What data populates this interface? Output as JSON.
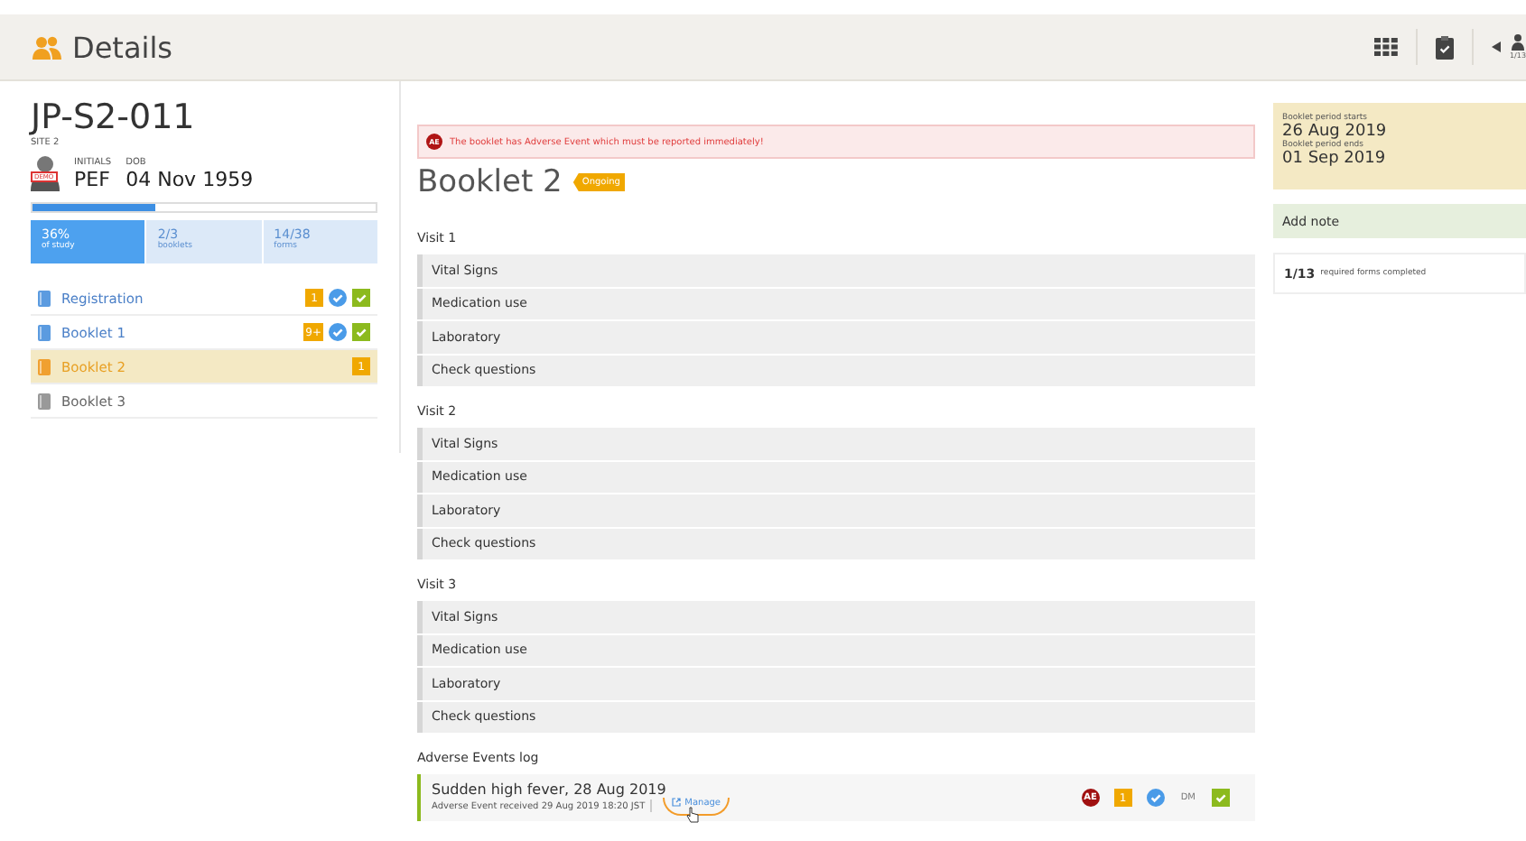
{
  "header": {
    "title": "Details",
    "user_count": "1/13"
  },
  "subject": {
    "id": "JP-S2-011",
    "site": "SITE 2",
    "avatar_tag": "DEMO",
    "initials_label": "INITIALS",
    "initials": "PEF",
    "dob_label": "DOB",
    "dob": "04 Nov 1959",
    "progress": {
      "level": 0.36
    },
    "stats": [
      {
        "value": "36%",
        "label": "of study",
        "selected": true
      },
      {
        "value": "2/3",
        "label": "booklets",
        "selected": false
      },
      {
        "value": "14/38",
        "label": "forms",
        "selected": false
      }
    ]
  },
  "booklets": [
    {
      "label": "Registration",
      "selected": false,
      "locked": false,
      "badges": [
        {
          "kind": "count",
          "text": "1"
        },
        {
          "kind": "verified"
        },
        {
          "kind": "check"
        }
      ]
    },
    {
      "label": "Booklet 1",
      "selected": false,
      "locked": false,
      "badges": [
        {
          "kind": "count",
          "text": "9+"
        },
        {
          "kind": "verified"
        },
        {
          "kind": "check"
        }
      ]
    },
    {
      "label": "Booklet 2",
      "selected": true,
      "locked": false,
      "badges": [
        {
          "kind": "count",
          "text": "1"
        }
      ]
    },
    {
      "label": "Booklet 3",
      "selected": false,
      "locked": true
    }
  ],
  "alert": {
    "badge": "AE",
    "text": "The booklet has Adverse Event which must be reported immediately!"
  },
  "booklet": {
    "title": "Booklet 2",
    "status": "Ongoing"
  },
  "visits": [
    {
      "title": "Visit 1",
      "forms": [
        "Vital Signs",
        "Medication use",
        "Laboratory",
        "Check questions"
      ]
    },
    {
      "title": "Visit 2",
      "forms": [
        "Vital Signs",
        "Medication use",
        "Laboratory",
        "Check questions"
      ]
    },
    {
      "title": "Visit 3",
      "forms": [
        "Vital Signs",
        "Medication use",
        "Laboratory",
        "Check questions"
      ]
    }
  ],
  "adverse_events": {
    "title": "Adverse Events log",
    "items": [
      {
        "title": "Sudden high fever, 28 Aug 2019",
        "received": "Adverse Event received 29 Aug 2019 18:20 JST",
        "link": "Manage",
        "badges": [
          {
            "kind": "ae",
            "text": "AE"
          },
          {
            "kind": "count",
            "text": "1"
          },
          {
            "kind": "verified"
          },
          {
            "kind": "dm",
            "text": "DM"
          },
          {
            "kind": "check"
          }
        ]
      }
    ]
  },
  "period": {
    "start_label": "Booklet period starts",
    "start": "26 Aug 2019",
    "end_label": "Booklet period ends",
    "end": "01 Sep 2019"
  },
  "note": {
    "label": "Add note"
  },
  "required": {
    "count": "1/13",
    "label": "required forms completed"
  }
}
